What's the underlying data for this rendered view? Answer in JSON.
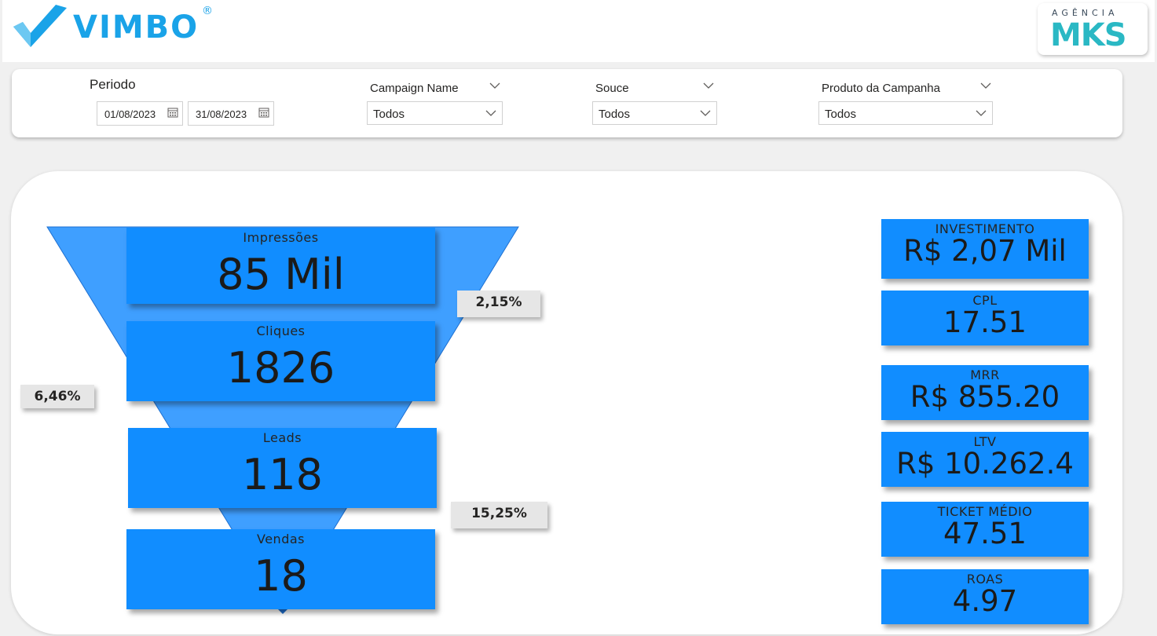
{
  "brand": {
    "vimbo": "VIMBO",
    "vimbo_reg": "®",
    "agency_top": "AGÊNCIA",
    "agency_main": "MKS"
  },
  "filters": {
    "periodo_label": "Periodo",
    "date_start": "01/08/2023",
    "date_end": "31/08/2023",
    "campaign": {
      "label": "Campaign Name",
      "value": "Todos"
    },
    "source": {
      "label": "Souce",
      "value": "Todos"
    },
    "produto": {
      "label": "Produto da Campanha",
      "value": "Todos"
    }
  },
  "funnel": {
    "stages": [
      {
        "label": "Impressões",
        "value": "85 Mil"
      },
      {
        "label": "Cliques",
        "value": "1826"
      },
      {
        "label": "Leads",
        "value": "118"
      },
      {
        "label": "Vendas",
        "value": "18"
      }
    ],
    "rates": {
      "ctr": "2,15%",
      "click_to_lead": "6,46%",
      "lead_to_sale": "15,25%"
    },
    "color": "#118dff"
  },
  "kpis": [
    {
      "label": "INVESTIMENTO",
      "value": "R$ 2,07 Mil"
    },
    {
      "label": "CPL",
      "value": "17.51"
    },
    {
      "label": "MRR",
      "value": "R$ 855.20"
    },
    {
      "label": "LTV",
      "value": "R$ 10.262.4"
    },
    {
      "label": "TICKET MÉDIO",
      "value": "47.51"
    },
    {
      "label": "ROAS",
      "value": "4.97"
    }
  ],
  "icons": [
    "calendar-icon",
    "chevron-down-icon"
  ]
}
